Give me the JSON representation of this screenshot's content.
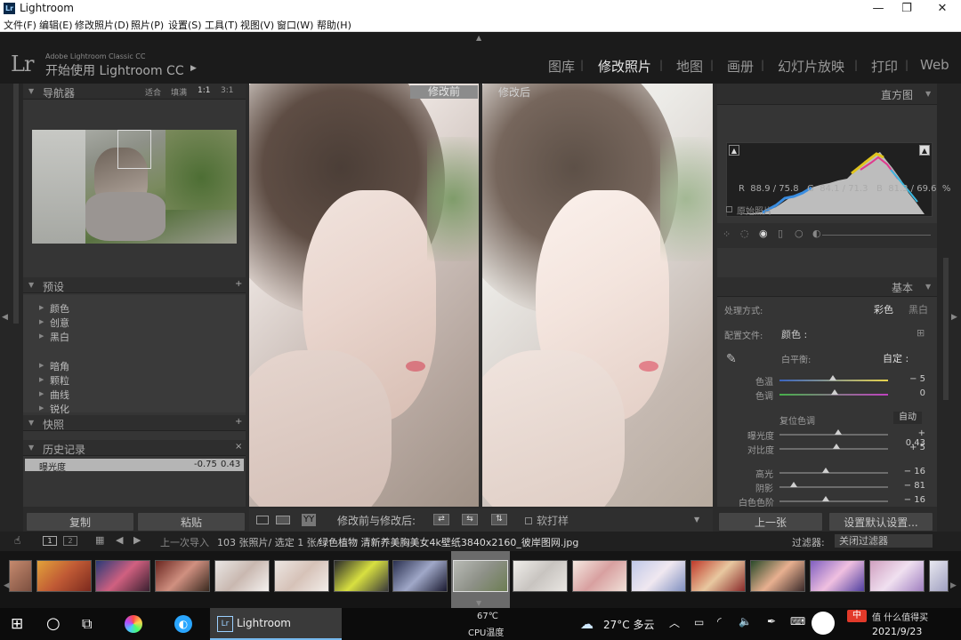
{
  "window": {
    "title": "Lightroom",
    "minimize": "—",
    "maximize": "❐",
    "close": "✕",
    "app_icon": "Lr"
  },
  "menu": [
    "文件(F)",
    "编辑(E)",
    "修改照片(D)",
    "照片(P)",
    "设置(S)",
    "工具(T)",
    "视图(V)",
    "窗口(W)",
    "帮助(H)"
  ],
  "identity": {
    "logo": "Lr",
    "product": "Adobe Lightroom Classic CC",
    "start": "开始使用 Lightroom CC",
    "arrow": "▶"
  },
  "modules": [
    {
      "label": "图库",
      "active": false
    },
    {
      "label": "修改照片",
      "active": true
    },
    {
      "label": "地图",
      "active": false
    },
    {
      "label": "画册",
      "active": false
    },
    {
      "label": "幻灯片放映",
      "active": false
    },
    {
      "label": "打印",
      "active": false
    },
    {
      "label": "Web",
      "active": false
    }
  ],
  "navigator": {
    "title": "导航器",
    "zoom": [
      "适合",
      "填满",
      "1:1",
      "3:1"
    ]
  },
  "presets": {
    "title": "预设",
    "add": "+",
    "groups1": [
      "颜色",
      "创意",
      "黑白"
    ],
    "groups2": [
      "暗角",
      "颗粒",
      "曲线",
      "锐化"
    ]
  },
  "snapshots": {
    "title": "快照",
    "add": "+"
  },
  "history": {
    "title": "历史记录",
    "close": "×",
    "item_label": "曝光度",
    "item_from": "-0.75",
    "item_to": "0.43"
  },
  "left_buttons": {
    "copy": "复制",
    "paste": "粘贴"
  },
  "compare": {
    "before": "修改前",
    "after": "修改后"
  },
  "toolbar": {
    "view_mode": "YY",
    "compare_label": "修改前与修改后:",
    "soft_proof": "软打样"
  },
  "histogram": {
    "title": "直方图",
    "readout": "R  88.9 / 75.8   G  84.1 / 71.3   B  81.3 / 69.6  %",
    "original": "原始照片"
  },
  "basic": {
    "title": "基本",
    "treatment_label": "处理方式:",
    "treatment_color": "彩色",
    "treatment_bw": "黑白",
    "profile_label": "配置文件:",
    "profile_value": "颜色 :",
    "wb_label": "白平衡:",
    "wb_value": "自定 :",
    "temp_label": "色温",
    "temp_value": "− 5",
    "tint_label": "色调",
    "tint_value": "0",
    "tone_label": "复位色调",
    "auto": "自动",
    "exposure_label": "曝光度",
    "exposure_value": "+ 0.43",
    "contrast_label": "对比度",
    "contrast_value": "+ 5",
    "highlights_label": "高光",
    "highlights_value": "− 16",
    "shadows_label": "阴影",
    "shadows_value": "− 81",
    "whites_label": "白色色阶",
    "whites_value": "− 16"
  },
  "right_buttons": {
    "prev": "上一张",
    "defaults": "设置默认设置..."
  },
  "filmstrip_bar": {
    "pages": [
      "1",
      "2"
    ],
    "import": "上一次导入",
    "info": "103 张照片/ 选定 1 张/",
    "filename": "绿色植物 清新养美胸美女4k壁纸3840x2160_彼岸图网.jpg",
    "filter_label": "过滤器:",
    "filter_value": "关闭过滤器"
  },
  "taskbar": {
    "lightroom_label": "Lightroom",
    "cpu_temp": "67℃",
    "cpu_label": "CPU温度",
    "weather": "27°C 多云",
    "date": "2021/9/23",
    "ime": "中",
    "watermark": "值 什么值得买"
  }
}
